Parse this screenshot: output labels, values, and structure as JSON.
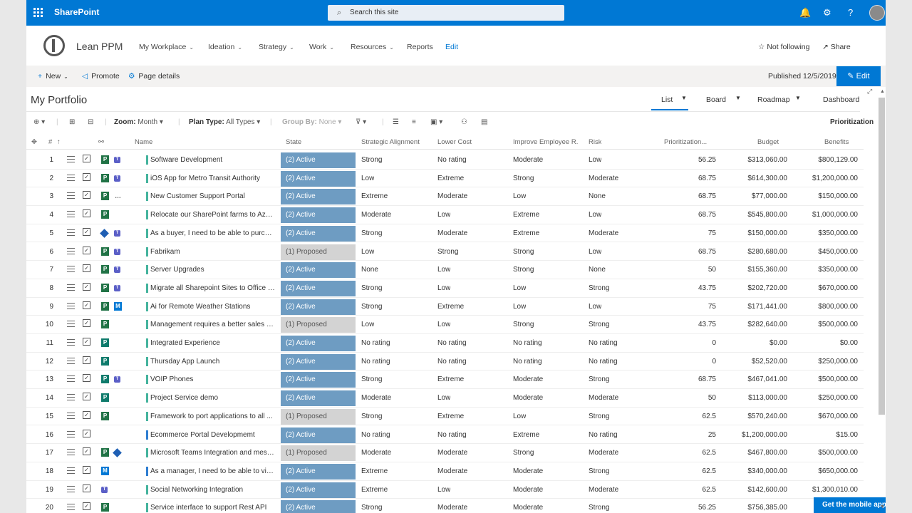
{
  "suite": {
    "brand": "SharePoint",
    "search_placeholder": "Search this site"
  },
  "site": {
    "name": "Lean PPM",
    "nav": [
      "My Workplace",
      "Ideation",
      "Strategy",
      "Work",
      "Resources",
      "Reports",
      "Edit"
    ],
    "follow_label": "Not following",
    "share_label": "Share"
  },
  "commandbar": {
    "new_label": "New",
    "promote_label": "Promote",
    "page_details_label": "Page details",
    "published": "Published 12/5/2019",
    "edit_label": "Edit"
  },
  "portfolio": {
    "title": "My Portfolio",
    "views": [
      "List",
      "Board",
      "Roadmap",
      "Dashboard"
    ],
    "toolbar": {
      "zoom_label": "Zoom:",
      "zoom_value": "Month",
      "plan_type_label": "Plan Type:",
      "plan_type_value": "All Types",
      "group_by_label": "Group By:",
      "group_by_value": "None",
      "prioritization_label": "Prioritization"
    },
    "columns": [
      "#",
      "Name",
      "State",
      "Strategic Alignment",
      "Lower Cost",
      "Improve Employee R...",
      "Risk",
      "Prioritization...",
      "Budget",
      "Benefits"
    ],
    "rows": [
      {
        "n": "1",
        "name": "Software Development",
        "state": "(2) Active",
        "sa": "Strong",
        "lc": "No rating",
        "ie": "Moderate",
        "risk": "Low",
        "prio": "56.25",
        "budget": "$313,060.00",
        "benefits": "$800,129.00",
        "icons": [
          "P",
          "T"
        ]
      },
      {
        "n": "2",
        "name": "iOS App for Metro Transit Authority",
        "state": "(2) Active",
        "sa": "Low",
        "lc": "Extreme",
        "ie": "Strong",
        "risk": "Moderate",
        "prio": "68.75",
        "budget": "$614,300.00",
        "benefits": "$1,200,000.00",
        "icons": [
          "P",
          "T"
        ]
      },
      {
        "n": "3",
        "name": "New Customer Support Portal",
        "state": "(2) Active",
        "sa": "Extreme",
        "lc": "Moderate",
        "ie": "Low",
        "risk": "None",
        "prio": "68.75",
        "budget": "$77,000.00",
        "benefits": "$150,000.00",
        "icons": [
          "P",
          "..."
        ]
      },
      {
        "n": "4",
        "name": "Relocate our SharePoint farms to Azur...",
        "state": "(2) Active",
        "sa": "Moderate",
        "lc": "Low",
        "ie": "Extreme",
        "risk": "Low",
        "prio": "68.75",
        "budget": "$545,800.00",
        "benefits": "$1,000,000.00",
        "icons": [
          "P"
        ]
      },
      {
        "n": "5",
        "name": "As a buyer, I need to be able to purcha...",
        "state": "(2) Active",
        "sa": "Strong",
        "lc": "Moderate",
        "ie": "Extreme",
        "risk": "Moderate",
        "prio": "75",
        "budget": "$150,000.00",
        "benefits": "$350,000.00",
        "icons": [
          "D",
          "T"
        ]
      },
      {
        "n": "6",
        "name": "Fabrikam",
        "state": "(1) Proposed",
        "sa": "Low",
        "lc": "Strong",
        "ie": "Strong",
        "risk": "Low",
        "prio": "68.75",
        "budget": "$280,680.00",
        "benefits": "$450,000.00",
        "icons": [
          "P",
          "T"
        ]
      },
      {
        "n": "7",
        "name": "Server Upgrades",
        "state": "(2) Active",
        "sa": "None",
        "lc": "Low",
        "ie": "Strong",
        "risk": "None",
        "prio": "50",
        "budget": "$155,360.00",
        "benefits": "$350,000.00",
        "icons": [
          "P",
          "T"
        ]
      },
      {
        "n": "8",
        "name": "Migrate all Sharepoint Sites to Office 3...",
        "state": "(2) Active",
        "sa": "Strong",
        "lc": "Low",
        "ie": "Low",
        "risk": "Strong",
        "prio": "43.75",
        "budget": "$202,720.00",
        "benefits": "$670,000.00",
        "icons": [
          "P",
          "T"
        ]
      },
      {
        "n": "9",
        "name": "Ai for Remote Weather Stations",
        "state": "(2) Active",
        "sa": "Strong",
        "lc": "Extreme",
        "ie": "Low",
        "risk": "Low",
        "prio": "75",
        "budget": "$171,441.00",
        "benefits": "$800,000.00",
        "icons": [
          "P",
          "M"
        ]
      },
      {
        "n": "10",
        "name": "Management requires a better sales re...",
        "state": "(1) Proposed",
        "sa": "Low",
        "lc": "Low",
        "ie": "Strong",
        "risk": "Strong",
        "prio": "43.75",
        "budget": "$282,640.00",
        "benefits": "$500,000.00",
        "icons": [
          "P"
        ]
      },
      {
        "n": "11",
        "name": "Integrated Experience",
        "state": "(2) Active",
        "sa": "No rating",
        "lc": "No rating",
        "ie": "No rating",
        "risk": "No rating",
        "prio": "0",
        "budget": "$0.00",
        "benefits": "$0.00",
        "icons": [
          "L"
        ]
      },
      {
        "n": "12",
        "name": "Thursday App Launch",
        "state": "(2) Active",
        "sa": "No rating",
        "lc": "No rating",
        "ie": "No rating",
        "risk": "No rating",
        "prio": "0",
        "budget": "$52,520.00",
        "benefits": "$250,000.00",
        "icons": [
          "L"
        ]
      },
      {
        "n": "13",
        "name": "VOIP Phones",
        "state": "(2) Active",
        "sa": "Strong",
        "lc": "Extreme",
        "ie": "Moderate",
        "risk": "Strong",
        "prio": "68.75",
        "budget": "$467,041.00",
        "benefits": "$500,000.00",
        "icons": [
          "L",
          "T"
        ]
      },
      {
        "n": "14",
        "name": "Project Service demo",
        "state": "(2) Active",
        "sa": "Moderate",
        "lc": "Low",
        "ie": "Moderate",
        "risk": "Moderate",
        "prio": "50",
        "budget": "$113,000.00",
        "benefits": "$250,000.00",
        "icons": [
          "L"
        ]
      },
      {
        "n": "15",
        "name": "Framework to port applications to all ...",
        "state": "(1) Proposed",
        "sa": "Strong",
        "lc": "Extreme",
        "ie": "Low",
        "risk": "Strong",
        "prio": "62.5",
        "budget": "$570,240.00",
        "benefits": "$670,000.00",
        "icons": [
          "P"
        ]
      },
      {
        "n": "16",
        "name": "Ecommerce Portal Developmemt",
        "state": "(2) Active",
        "sa": "No rating",
        "lc": "No rating",
        "ie": "Extreme",
        "risk": "No rating",
        "prio": "25",
        "budget": "$1,200,000.00",
        "benefits": "$15.00",
        "icons": []
      },
      {
        "n": "17",
        "name": "Microsoft Teams Integration and mess...",
        "state": "(1) Proposed",
        "sa": "Moderate",
        "lc": "Moderate",
        "ie": "Strong",
        "risk": "Moderate",
        "prio": "62.5",
        "budget": "$467,800.00",
        "benefits": "$500,000.00",
        "icons": [
          "P",
          "D"
        ]
      },
      {
        "n": "18",
        "name": "As a manager, I need to be able to vie...",
        "state": "(2) Active",
        "sa": "Extreme",
        "lc": "Moderate",
        "ie": "Moderate",
        "risk": "Strong",
        "prio": "62.5",
        "budget": "$340,000.00",
        "benefits": "$650,000.00",
        "icons": [
          "M"
        ]
      },
      {
        "n": "19",
        "name": "Social Networking Integration",
        "state": "(2) Active",
        "sa": "Extreme",
        "lc": "Low",
        "ie": "Moderate",
        "risk": "Moderate",
        "prio": "62.5",
        "budget": "$142,600.00",
        "benefits": "$1,300,010.00",
        "icons": [
          "T"
        ]
      },
      {
        "n": "20",
        "name": "Service interface to support Rest API",
        "state": "(2) Active",
        "sa": "Strong",
        "lc": "Moderate",
        "ie": "Moderate",
        "risk": "Strong",
        "prio": "56.25",
        "budget": "$756,385.00",
        "benefits": "",
        "icons": [
          "P"
        ]
      }
    ]
  },
  "mobile_banner": "Get the mobile app"
}
